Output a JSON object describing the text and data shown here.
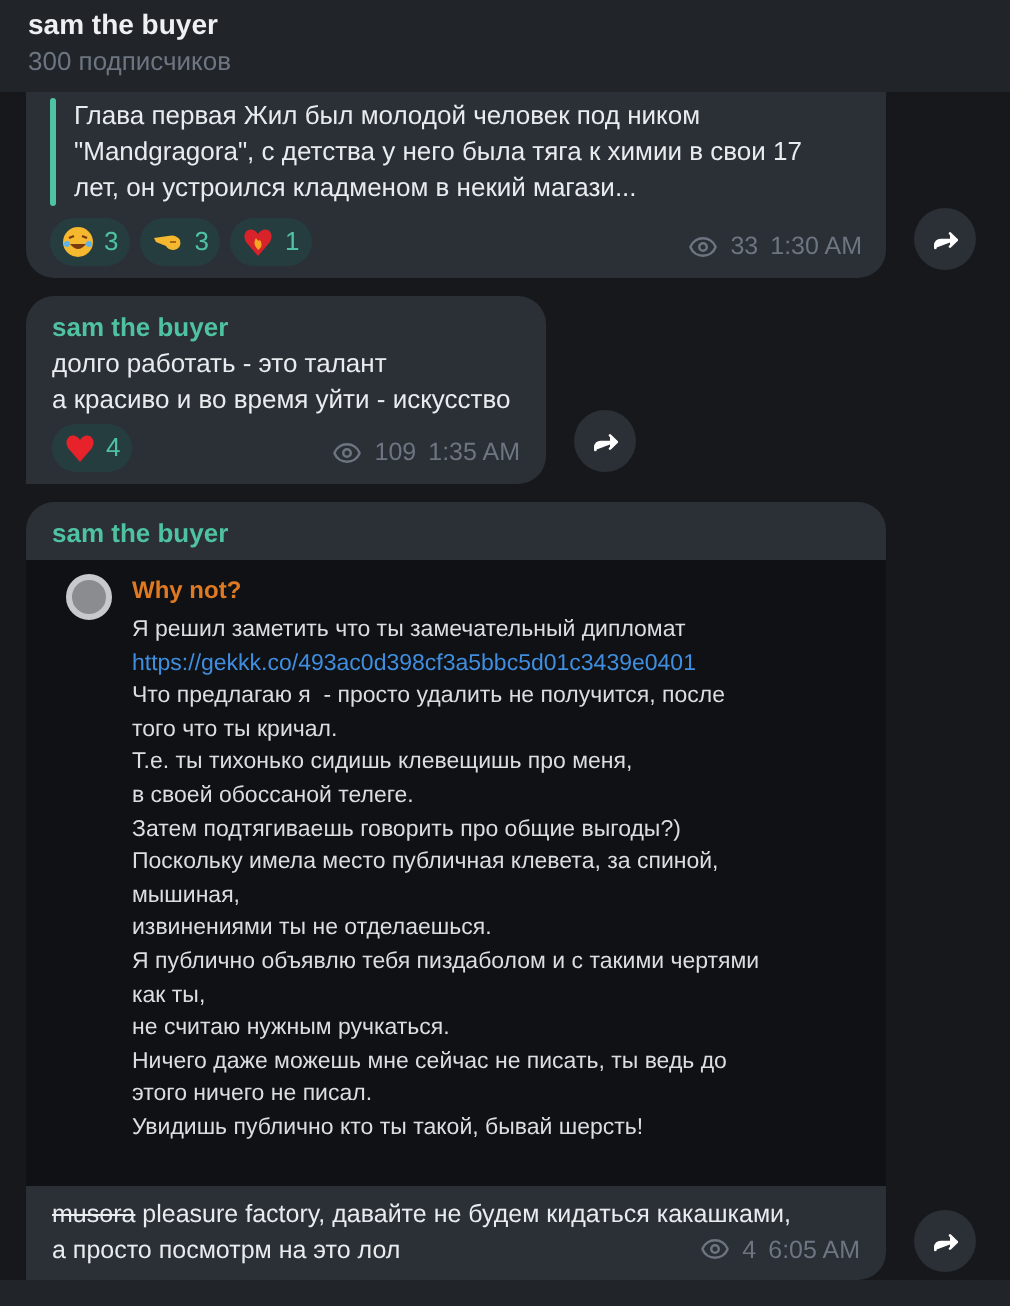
{
  "header": {
    "title": "sam the buyer",
    "subtitle": "300 подписчиков"
  },
  "messages": [
    {
      "kind": "quote",
      "lines": [
        "Глава первая Жил был молодой человек под ником",
        "\"Mandgragora\", с детства у него была тяга к химии в свои 17",
        "лет, он устроился кладменом в некий магази..."
      ],
      "reactions": [
        {
          "kind": "laugh",
          "count": "3"
        },
        {
          "kind": "point",
          "count": "3"
        },
        {
          "kind": "fire-heart",
          "count": "1"
        }
      ],
      "views": "33",
      "time": "1:30 AM"
    },
    {
      "kind": "text",
      "author": "sam the buyer",
      "lines": [
        "долго работать - это талант",
        "а красиво и во время уйти - искусство"
      ],
      "reactions": [
        {
          "kind": "heart",
          "count": "4"
        }
      ],
      "views": "109",
      "time": "1:35 AM"
    },
    {
      "kind": "screenshot",
      "author": "sam the buyer",
      "shot": {
        "author": "Why not?",
        "lines": [
          {
            "kind": "text",
            "text": "Я решил заметить что ты замечательный дипломат"
          },
          {
            "kind": "link",
            "text": "https://gekkk.co/493ac0d398cf3a5bbc5d01c3439e0401"
          },
          {
            "kind": "text",
            "text": "Что предлагаю я  - просто удалить не получится, после"
          },
          {
            "kind": "text",
            "text": "того что ты кричал."
          },
          {
            "kind": "text",
            "text": "Т.е. ты тихонько сидишь клевещишь про меня,"
          },
          {
            "kind": "text",
            "text": "в своей обоссаной телеге."
          },
          {
            "kind": "text",
            "text": "Затем подтягиваешь говорить про общие выгоды?)"
          },
          {
            "kind": "text",
            "text": "Поскольку имела место публичная клевета, за спиной,"
          },
          {
            "kind": "text",
            "text": "мышиная,"
          },
          {
            "kind": "text",
            "text": "извинениями ты не отделаешься."
          },
          {
            "kind": "text",
            "text": "Я публично объявлю тебя пиздаболом и с такими чертями"
          },
          {
            "kind": "text",
            "text": "как ты,"
          },
          {
            "kind": "text",
            "text": "не считаю нужным ручкаться."
          },
          {
            "kind": "text",
            "text": "Ничего даже можешь мне сейчас не писать, ты ведь до"
          },
          {
            "kind": "text",
            "text": "этого ничего не писал."
          },
          {
            "kind": "text",
            "text": "Увидишь публично кто ты такой, бывай шерсть!"
          }
        ]
      },
      "caption": {
        "struck": "musora",
        "lines": [
          "pleasure factory, давайте не будем кидаться какашками,",
          "а просто посмотрм на это лол"
        ]
      },
      "views": "4",
      "time": "6:05 AM"
    }
  ]
}
